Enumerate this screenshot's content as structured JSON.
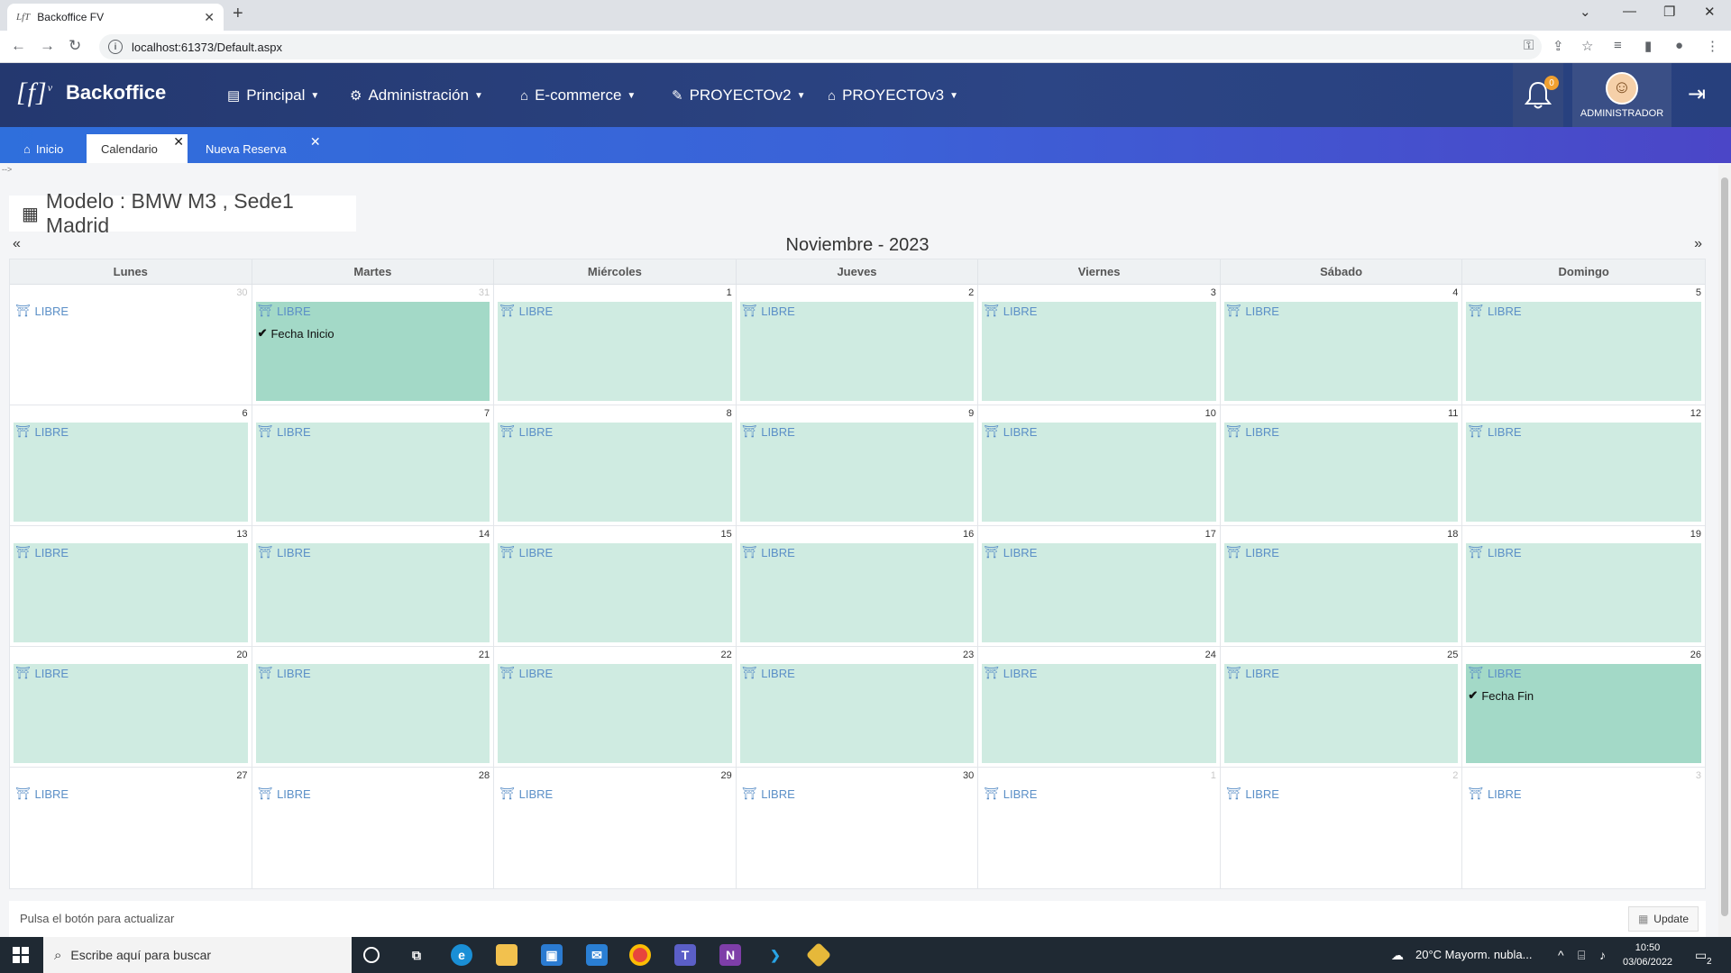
{
  "browser": {
    "tab_title": "Backoffice FV",
    "tab_favicon": "LfT",
    "new_tab": "+",
    "url": "localhost:61373/Default.aspx"
  },
  "header": {
    "logo_text": "[f]",
    "logo_sup": "v",
    "brand": "Backoffice",
    "menus": [
      {
        "label": "Principal",
        "icon": "building-icon"
      },
      {
        "label": "Administración",
        "icon": "users-cog-icon"
      },
      {
        "label": "E-commerce",
        "icon": "store-icon"
      },
      {
        "label": "PROYECTOv2",
        "icon": "edit-icon"
      },
      {
        "label": "PROYECTOv3",
        "icon": "store-icon"
      }
    ],
    "notifications_count": "0",
    "user_label": "ADMINISTRADOR"
  },
  "app_tabs": [
    {
      "label": "Inicio",
      "icon": "home-icon"
    },
    {
      "label": "Calendario"
    },
    {
      "label": "Nueva Reserva"
    }
  ],
  "comment_text": "-->",
  "model_title": "Modelo : BMW M3 , Sede1 Madrid",
  "calendar": {
    "prev": "«",
    "next": "»",
    "month_label": "Noviembre - 2023",
    "days_of_week": [
      "Lunes",
      "Martes",
      "Miércoles",
      "Jueves",
      "Viernes",
      "Sábado",
      "Domingo"
    ],
    "free_label": "LIBRE",
    "start_label": "Fecha Inicio",
    "end_label": "Fecha Fin",
    "weeks": [
      [
        {
          "n": "30",
          "other": true,
          "slot": "none"
        },
        {
          "n": "31",
          "other": true,
          "slot": "sel",
          "mark": "start"
        },
        {
          "n": "1",
          "slot": "free"
        },
        {
          "n": "2",
          "slot": "free"
        },
        {
          "n": "3",
          "slot": "free"
        },
        {
          "n": "4",
          "slot": "free"
        },
        {
          "n": "5",
          "slot": "free"
        }
      ],
      [
        {
          "n": "6",
          "slot": "free"
        },
        {
          "n": "7",
          "slot": "free"
        },
        {
          "n": "8",
          "slot": "free"
        },
        {
          "n": "9",
          "slot": "free"
        },
        {
          "n": "10",
          "slot": "free"
        },
        {
          "n": "11",
          "slot": "free"
        },
        {
          "n": "12",
          "slot": "free"
        }
      ],
      [
        {
          "n": "13",
          "slot": "free"
        },
        {
          "n": "14",
          "slot": "free"
        },
        {
          "n": "15",
          "slot": "free"
        },
        {
          "n": "16",
          "slot": "free"
        },
        {
          "n": "17",
          "slot": "free"
        },
        {
          "n": "18",
          "slot": "free"
        },
        {
          "n": "19",
          "slot": "free"
        }
      ],
      [
        {
          "n": "20",
          "slot": "free"
        },
        {
          "n": "21",
          "slot": "free"
        },
        {
          "n": "22",
          "slot": "free"
        },
        {
          "n": "23",
          "slot": "free"
        },
        {
          "n": "24",
          "slot": "free"
        },
        {
          "n": "25",
          "slot": "free"
        },
        {
          "n": "26",
          "slot": "sel",
          "mark": "end"
        }
      ],
      [
        {
          "n": "27",
          "slot": "none"
        },
        {
          "n": "28",
          "slot": "none"
        },
        {
          "n": "29",
          "slot": "none"
        },
        {
          "n": "30",
          "slot": "none"
        },
        {
          "n": "1",
          "other": true,
          "slot": "none"
        },
        {
          "n": "2",
          "other": true,
          "slot": "none"
        },
        {
          "n": "3",
          "other": true,
          "slot": "none"
        }
      ]
    ]
  },
  "update_bar": {
    "text": "Pulsa el botón para actualizar",
    "button": "Update"
  },
  "taskbar": {
    "search_placeholder": "Escribe aquí para buscar",
    "weather": "20°C  Mayorm. nubla...",
    "time": "10:50",
    "date": "03/06/2022",
    "notif": "2"
  },
  "colors": {
    "header_bg": "#253a73",
    "tabs_bg": "#3b62d8",
    "free_slot": "#cfebe1",
    "selected_slot": "#a3d9c7",
    "libre_text": "#5b8fc7"
  }
}
